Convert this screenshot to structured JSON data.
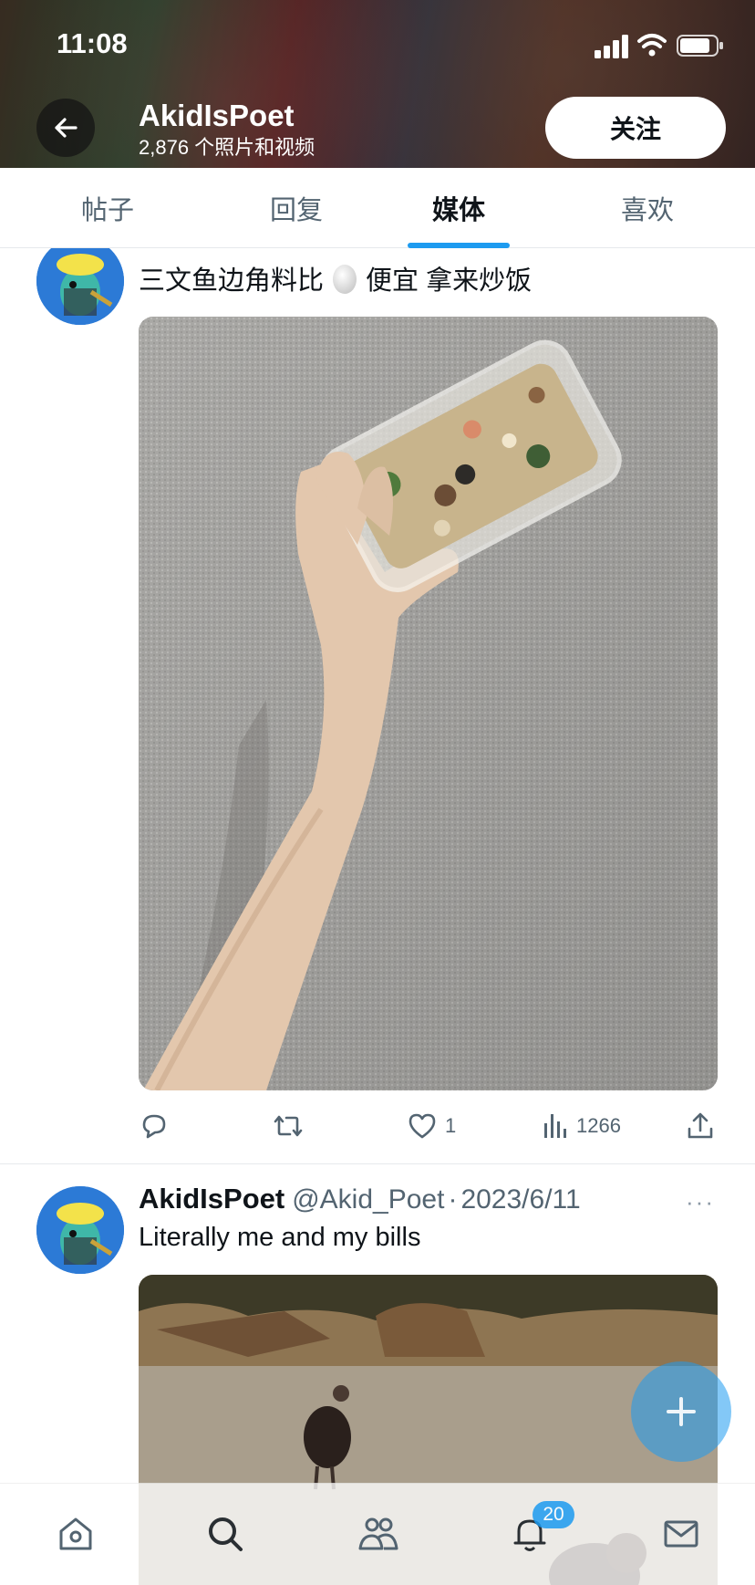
{
  "status_bar": {
    "time": "11:08"
  },
  "header": {
    "profile_name": "AkidIsPoet",
    "media_count": "2,876 个照片和视频",
    "follow_label": "关注"
  },
  "tabs": [
    {
      "label": "帖子"
    },
    {
      "label": "回复"
    },
    {
      "label": "媒体"
    },
    {
      "label": "喜欢"
    }
  ],
  "posts": [
    {
      "text_before": "三文鱼边角料比",
      "text_after": "便宜 拿来炒饭",
      "stats": {
        "likes": "1",
        "views": "1266"
      }
    },
    {
      "name": "AkidIsPoet",
      "handle": "@Akid_Poet",
      "date": "2023/6/11",
      "more": "···",
      "text": "Literally me and my bills"
    }
  ],
  "bottom_nav": {
    "items": [
      "home-icon",
      "search-icon",
      "communities-icon",
      "notifications-icon",
      "messages-icon"
    ],
    "notification_count": "20"
  },
  "colors": {
    "accent": "#1d9bf0",
    "text": "#0f1419",
    "muted": "#536471"
  }
}
